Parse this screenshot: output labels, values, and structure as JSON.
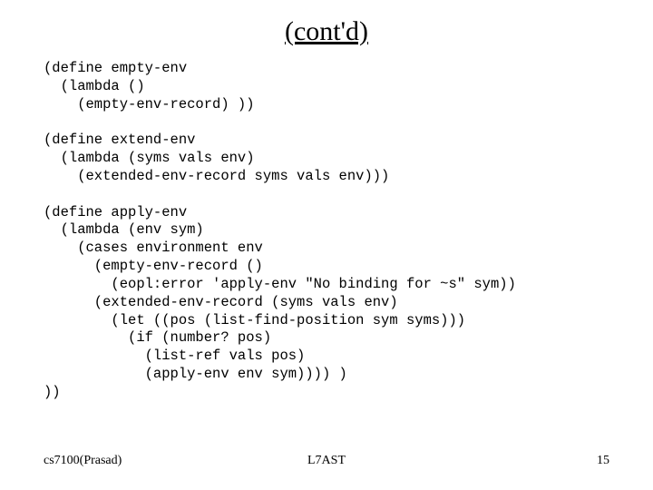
{
  "title": "(cont'd)",
  "code": "(define empty-env\n  (lambda ()\n    (empty-env-record) ))\n\n(define extend-env\n  (lambda (syms vals env)\n    (extended-env-record syms vals env)))\n\n(define apply-env\n  (lambda (env sym)\n    (cases environment env\n      (empty-env-record ()\n        (eopl:error 'apply-env \"No binding for ~s\" sym))\n      (extended-env-record (syms vals env)\n        (let ((pos (list-find-position sym syms)))\n          (if (number? pos)\n            (list-ref vals pos)\n            (apply-env env sym)))) )\n))",
  "footer": {
    "left": "cs7100(Prasad)",
    "center": "L7AST",
    "right": "15"
  }
}
